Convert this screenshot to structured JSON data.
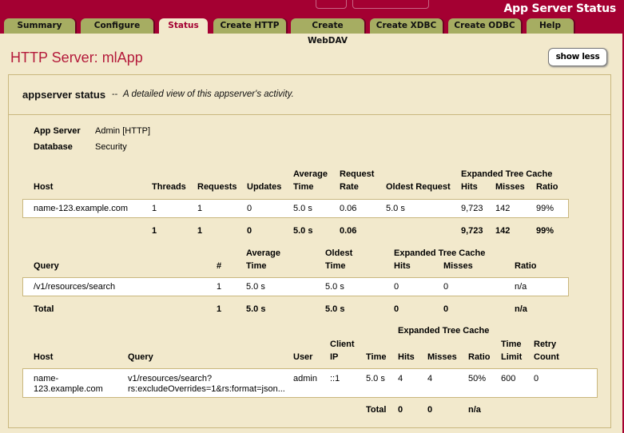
{
  "header": {
    "app_title": "App Server Status",
    "tabs": [
      {
        "label": "Summary",
        "active": false
      },
      {
        "label": "Configure",
        "active": false
      },
      {
        "label": "Status",
        "active": true
      },
      {
        "label": "Create HTTP",
        "active": false
      },
      {
        "label": "Create WebDAV",
        "active": false
      },
      {
        "label": "Create XDBC",
        "active": false
      },
      {
        "label": "Create ODBC",
        "active": false
      },
      {
        "label": "Help",
        "active": false
      }
    ]
  },
  "page": {
    "title": "HTTP Server: mlApp",
    "show_less_label": "show less"
  },
  "panel": {
    "title": "appserver status",
    "separator": "--",
    "description": "A detailed view of this appserver's activity.",
    "info": [
      {
        "label": "App Server",
        "value": "Admin [HTTP]"
      },
      {
        "label": "Database",
        "value": "Security"
      }
    ]
  },
  "host_table": {
    "group_header": "Expanded Tree Cache",
    "columns": [
      "Host",
      "Threads",
      "Requests",
      "Updates",
      "Average Time",
      "Request Rate",
      "Oldest Request",
      "Hits",
      "Misses",
      "Ratio"
    ],
    "column_top": {
      "avg": "Average",
      "rate": "Request"
    },
    "column_bottom": {
      "avg": "Time",
      "rate": "Rate"
    },
    "rows": [
      {
        "host": "name-123.example.com",
        "threads": "1",
        "requests": "1",
        "updates": "0",
        "avg_time": "5.0 s",
        "rate": "0.06",
        "oldest": "5.0 s",
        "hits": "9,723",
        "misses": "142",
        "ratio": "99%"
      }
    ],
    "totals": {
      "threads": "1",
      "requests": "1",
      "updates": "0",
      "avg_time": "5.0 s",
      "rate": "0.06",
      "hits": "9,723",
      "misses": "142",
      "ratio": "99%"
    }
  },
  "query_table": {
    "group_header": "Expanded Tree Cache",
    "columns": {
      "query": "Query",
      "count": "#",
      "avg_top": "Average",
      "avg_bottom": "Time",
      "oldest_top": "Oldest",
      "oldest_bottom": "Time",
      "hits": "Hits",
      "misses": "Misses",
      "ratio": "Ratio"
    },
    "rows": [
      {
        "query": "/v1/resources/search",
        "count": "1",
        "avg_time": "5.0 s",
        "oldest_time": "5.0 s",
        "hits": "0",
        "misses": "0",
        "ratio": "n/a"
      }
    ],
    "totals": {
      "label": "Total",
      "count": "1",
      "avg_time": "5.0 s",
      "oldest_time": "5.0 s",
      "hits": "0",
      "misses": "0",
      "ratio": "n/a"
    }
  },
  "request_table": {
    "group_header": "Expanded Tree Cache",
    "columns": {
      "host": "Host",
      "query": "Query",
      "user": "User",
      "ip_top": "Client",
      "ip_bottom": "IP",
      "time": "Time",
      "hits": "Hits",
      "misses": "Misses",
      "ratio": "Ratio",
      "limit_top": "Time",
      "limit_bottom": "Limit",
      "retry_top": "Retry",
      "retry_bottom": "Count"
    },
    "rows": [
      {
        "host_line1": "name-",
        "host_line2": "123.example.com",
        "query_line1": "v1/resources/search?",
        "query_line2": "rs:excludeOverrides=1&rs:format=json...",
        "user": "admin",
        "ip": "::1",
        "time": "5.0 s",
        "hits": "4",
        "misses": "4",
        "ratio": "50%",
        "limit": "600",
        "retry": "0"
      }
    ],
    "totals": {
      "label": "Total",
      "hits": "0",
      "misses": "0",
      "ratio": "n/a"
    }
  }
}
